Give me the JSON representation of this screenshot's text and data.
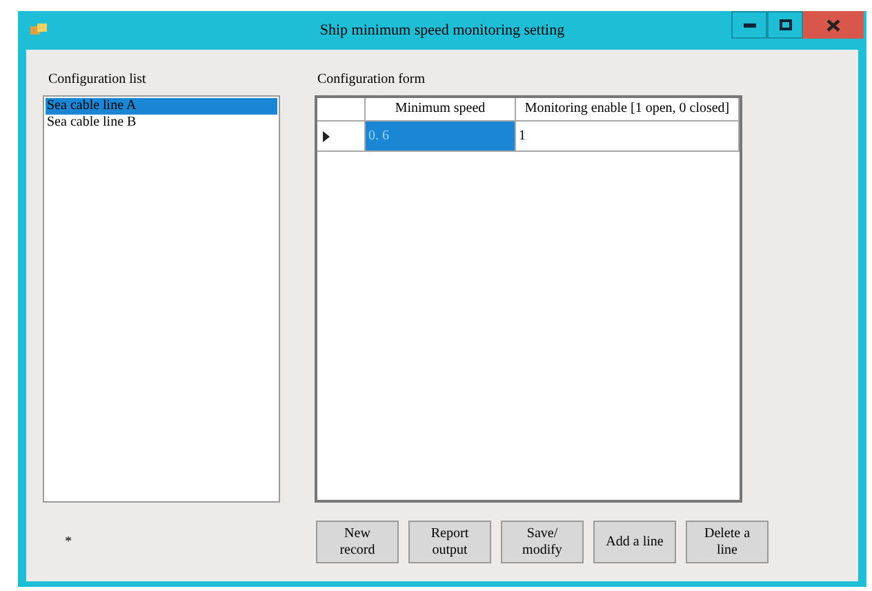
{
  "window": {
    "title": "Ship minimum speed monitoring setting"
  },
  "config_list": {
    "label": "Configuration list",
    "items": [
      {
        "text": "Sea cable line A",
        "selected": true
      },
      {
        "text": "Sea cable line B",
        "selected": false
      }
    ]
  },
  "config_form": {
    "label": "Configuration form",
    "columns": [
      "Minimum speed",
      "Monitoring enable [1 open, 0 closed]"
    ],
    "rows": [
      {
        "current": true,
        "cells": [
          {
            "text": "0. 6",
            "selected": true
          },
          {
            "text": "1",
            "selected": false
          }
        ]
      }
    ]
  },
  "status_mark": "*",
  "buttons": [
    "New record",
    "Report output",
    "Save/ modify",
    "Add a line",
    "Delete a line"
  ]
}
